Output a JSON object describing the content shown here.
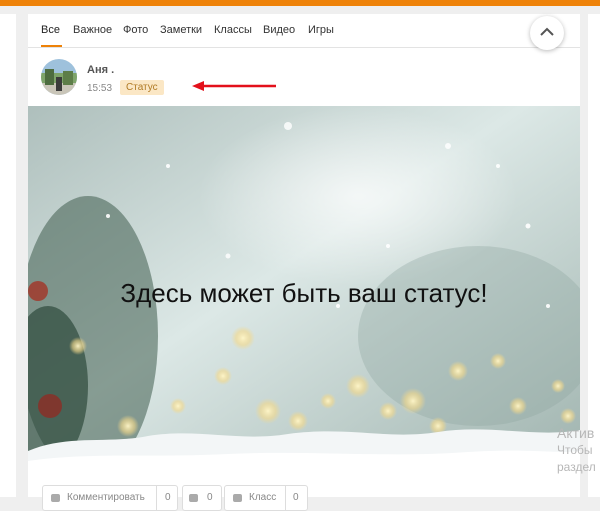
{
  "feed_tabs": [
    "Все",
    "Важное",
    "Фото",
    "Заметки",
    "Классы",
    "Видео",
    "Игры"
  ],
  "active_tab": "Все",
  "post": {
    "author": "Аня .",
    "time": "15:53",
    "badge": "Статус",
    "text": "Здесь может быть ваш статус!"
  },
  "actions": {
    "comment_label": "Комментировать",
    "comment_count": "0",
    "share_count": "0",
    "like_label": "Класс",
    "like_count": "0"
  },
  "watermark": {
    "line1": "Актив",
    "line2": "Чтобы",
    "line3": "раздел"
  },
  "colors": {
    "accent": "#ee8208",
    "badge_bg": "#fbe7c5",
    "badge_text": "#b07a24",
    "annotation_arrow": "#e3101b"
  },
  "icons": [
    "chevron-up-icon",
    "arrow-annotation-icon",
    "comment-icon",
    "share-icon",
    "like-icon"
  ]
}
